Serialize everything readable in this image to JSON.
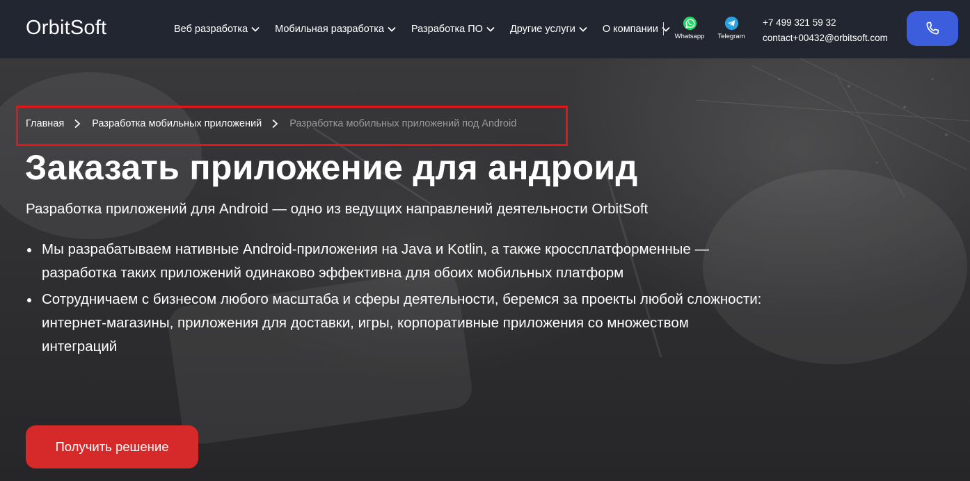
{
  "header": {
    "logo": "OrbitSoft",
    "nav": [
      {
        "label": "Веб разработка"
      },
      {
        "label": "Мобильная разработка"
      },
      {
        "label": "Разработка ПО"
      },
      {
        "label": "Другие услуги"
      },
      {
        "label": "О компании"
      }
    ],
    "messengers": [
      {
        "label": "Whatsapp",
        "icon": "whatsapp-icon",
        "color": "#25d366"
      },
      {
        "label": "Telegram",
        "icon": "telegram-icon",
        "color": "#2aa3e0"
      }
    ],
    "phone": "+7 499 321 59 32",
    "email": "contact+00432@orbitsoft.com",
    "call_button_icon": "phone-icon",
    "call_button_color": "#3c5ddc"
  },
  "breadcrumb": {
    "items": [
      {
        "label": "Главная"
      },
      {
        "label": "Разработка мобильных приложений"
      },
      {
        "label": "Разработка мобильных приложений под Android"
      }
    ],
    "highlight_color": "#e0161b"
  },
  "hero": {
    "title": "Заказать приложение для андроид",
    "subtitle": "Разработка приложений для Android — одно из ведущих направлений деятельности OrbitSoft",
    "features": [
      "Мы разрабатываем нативные Android-приложения на Java и Kotlin, а также кроссплатформенные — разработка таких приложений одинаково эффективна для обоих мобильных платформ",
      "Сотрудничаем с бизнесом любого масштаба и сферы деятельности, беремся за проекты любой сложности: интернет-магазины, приложения для доставки, игры, корпоративные приложения со множеством интеграций"
    ],
    "cta_label": "Получить решение",
    "cta_color": "#d62a2a"
  }
}
